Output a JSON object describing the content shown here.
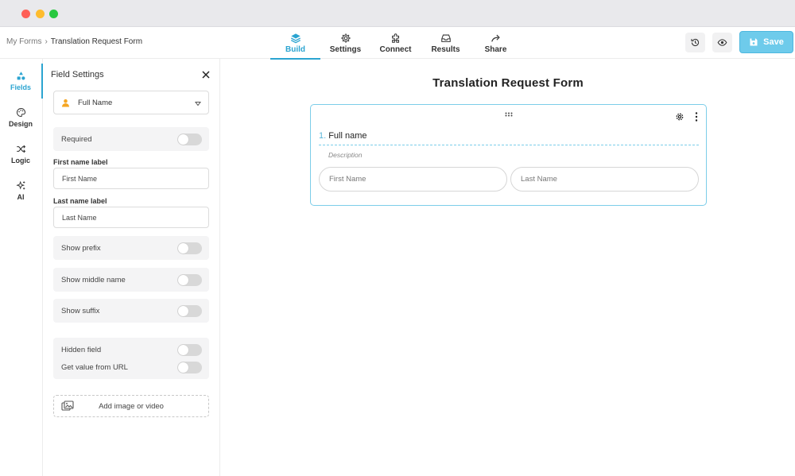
{
  "breadcrumb": {
    "root": "My Forms",
    "separator": "›",
    "current": "Translation Request Form"
  },
  "nav_tabs": [
    {
      "label": "Build",
      "icon": "layers-icon",
      "active": true
    },
    {
      "label": "Settings",
      "icon": "gear-icon",
      "active": false
    },
    {
      "label": "Connect",
      "icon": "puzzle-icon",
      "active": false
    },
    {
      "label": "Results",
      "icon": "inbox-icon",
      "active": false
    },
    {
      "label": "Share",
      "icon": "share-arrow-icon",
      "active": false
    }
  ],
  "toolbar": {
    "history_icon": "history-icon",
    "preview_icon": "eye-icon",
    "save_label": "Save"
  },
  "rail": [
    {
      "label": "Fields",
      "icon": "shapes-icon",
      "active": true
    },
    {
      "label": "Design",
      "icon": "palette-icon",
      "active": false
    },
    {
      "label": "Logic",
      "icon": "shuffle-icon",
      "active": false
    },
    {
      "label": "AI",
      "icon": "sparkle-icon",
      "active": false
    }
  ],
  "panel": {
    "title": "Field Settings",
    "field_type": "Full Name",
    "required_label": "Required",
    "first_name_label_title": "First name label",
    "first_name_label_value": "First Name",
    "last_name_label_title": "Last name label",
    "last_name_label_value": "Last Name",
    "show_prefix": "Show prefix",
    "show_middle": "Show middle name",
    "show_suffix": "Show suffix",
    "hidden_field": "Hidden field",
    "get_value_url": "Get value from URL",
    "add_media": "Add image or video"
  },
  "form": {
    "title": "Translation Request Form",
    "question_number": "1.",
    "question_title": "Full name",
    "description_placeholder": "Description",
    "first_name_placeholder": "First Name",
    "last_name_placeholder": "Last Name"
  },
  "colors": {
    "accent": "#2ba4d1",
    "save_button": "#6ecbeb",
    "card_border": "#7ccde9",
    "person_icon": "#f5a623"
  }
}
